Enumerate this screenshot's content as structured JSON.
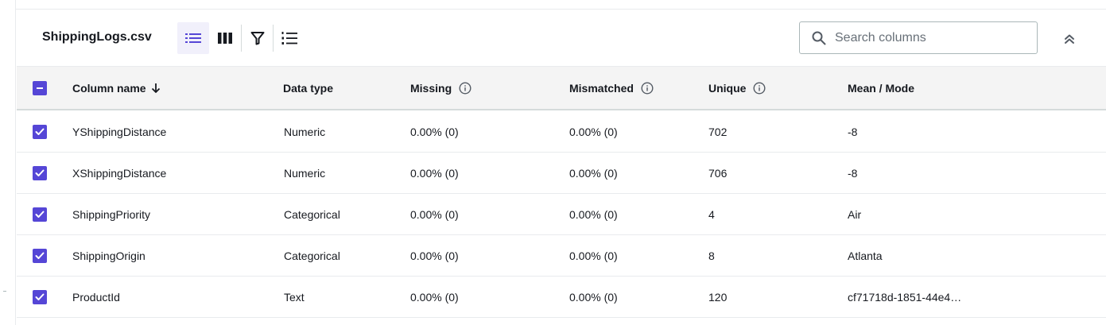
{
  "toolbar": {
    "file_name": "ShippingLogs.csv",
    "search_placeholder": "Search columns"
  },
  "colors": {
    "accent": "#5546d6",
    "active_view_bg": "#f1f0fb",
    "header_bg": "#f4f4f4"
  },
  "table": {
    "columns": {
      "name": "Column name",
      "type": "Data type",
      "missing": "Missing",
      "mismatched": "Mismatched",
      "unique": "Unique",
      "mean_mode": "Mean / Mode"
    },
    "rows": [
      {
        "name": "YShippingDistance",
        "type": "Numeric",
        "missing": "0.00% (0)",
        "mismatched": "0.00% (0)",
        "unique": "702",
        "mean_mode": "-8"
      },
      {
        "name": "XShippingDistance",
        "type": "Numeric",
        "missing": "0.00% (0)",
        "mismatched": "0.00% (0)",
        "unique": "706",
        "mean_mode": "-8"
      },
      {
        "name": "ShippingPriority",
        "type": "Categorical",
        "missing": "0.00% (0)",
        "mismatched": "0.00% (0)",
        "unique": "4",
        "mean_mode": "Air"
      },
      {
        "name": "ShippingOrigin",
        "type": "Categorical",
        "missing": "0.00% (0)",
        "mismatched": "0.00% (0)",
        "unique": "8",
        "mean_mode": "Atlanta"
      },
      {
        "name": "ProductId",
        "type": "Text",
        "missing": "0.00% (0)",
        "mismatched": "0.00% (0)",
        "unique": "120",
        "mean_mode": "cf71718d-1851-44e4…"
      }
    ]
  }
}
